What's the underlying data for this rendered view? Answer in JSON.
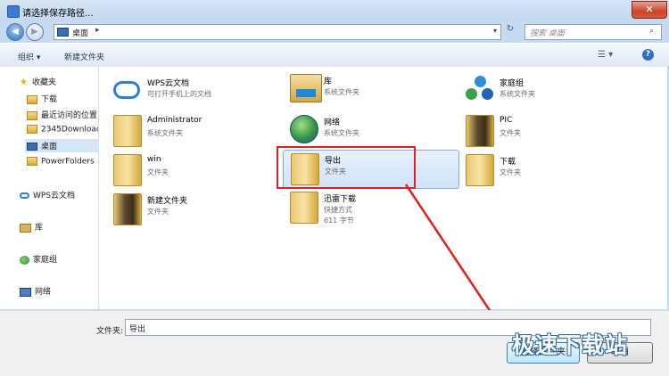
{
  "window": {
    "title": "请选择保存路径...",
    "close_glyph": "✕"
  },
  "nav": {
    "back_glyph": "◀",
    "forward_glyph": "▶",
    "address": "桌面",
    "address_sep": "▸",
    "address_drop": "▾",
    "refresh_glyph": "↻",
    "search_placeholder": "搜索 桌面",
    "search_glyph": "⌕"
  },
  "toolbar": {
    "organize": "组织 ▾",
    "new_folder": "新建文件夹",
    "view_glyph": "☰ ▾",
    "help": "?"
  },
  "sidebar": {
    "favorites": "收藏夹",
    "fav_items": [
      "下载",
      "最近访问的位置",
      "2345Downloads",
      "桌面",
      "PowerFolders"
    ],
    "wps": "WPS云文档",
    "library": "库",
    "homegroup": "家庭组",
    "network": "网络"
  },
  "items": [
    {
      "label": "WPS云文档",
      "sub": "可打开手机上的文档",
      "icon": "cloud-icon"
    },
    {
      "label": "库",
      "sub": "系统文件夹",
      "icon": "library-icon"
    },
    {
      "label": "家庭组",
      "sub": "系统文件夹",
      "icon": "homegroup-icon"
    },
    {
      "label": "Administrator",
      "sub": "系统文件夹",
      "icon": "user-folder-icon"
    },
    {
      "label": "网络",
      "sub": "系统文件夹",
      "icon": "network-icon"
    },
    {
      "label": "PIC",
      "sub": "文件夹",
      "icon": "folder-icon"
    },
    {
      "label": "win",
      "sub": "文件夹",
      "icon": "folder-icon"
    },
    {
      "label": "导出",
      "sub": "文件夹",
      "icon": "folder-icon"
    },
    {
      "label": "下载",
      "sub": "文件夹",
      "icon": "folder-icon"
    },
    {
      "label": "新建文件夹",
      "sub": "文件夹",
      "icon": "folder-icon"
    },
    {
      "label": "迅雷下载",
      "sub": "快捷方式",
      "sub2": "611 字节",
      "icon": "shortcut-folder-icon"
    }
  ],
  "bottom": {
    "folder_label": "文件夹:",
    "folder_value": "导出",
    "ok": "选择文件夹",
    "cancel": "取消"
  },
  "watermark": "极速下载站"
}
